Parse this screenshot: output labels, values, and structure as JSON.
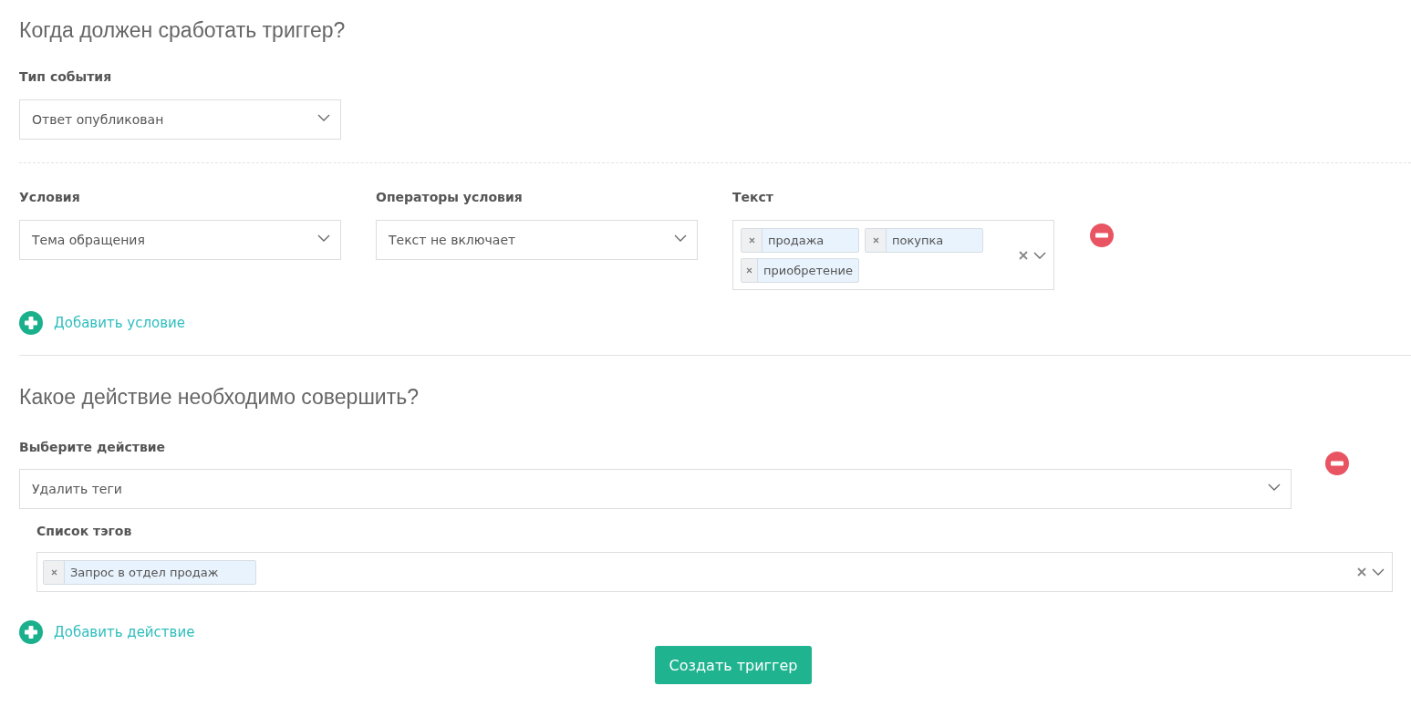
{
  "trigger_section": {
    "heading": "Когда должен сработать триггер?",
    "event_type": {
      "label": "Тип события",
      "value": "Ответ опубликован"
    }
  },
  "conditions": {
    "columns": [
      {
        "label": "Условия"
      },
      {
        "label": "Операторы условия"
      },
      {
        "label": "Текст"
      }
    ],
    "rows": [
      {
        "condition": "Тема обращения",
        "operator": "Текст не включает",
        "tags": [
          "продажа",
          "покупка",
          "приобретение"
        ]
      }
    ],
    "add_link": "Добавить условие"
  },
  "action_section": {
    "heading": "Какое действие необходимо совершить?",
    "actions": [
      {
        "label": "Выберите действие",
        "value": "Удалить теги",
        "tag_list": {
          "label": "Список тэгов",
          "tags": [
            "Запрос в отдел продаж"
          ]
        }
      }
    ],
    "add_link": "Добавить действие"
  },
  "submit_button": "Создать триггер"
}
